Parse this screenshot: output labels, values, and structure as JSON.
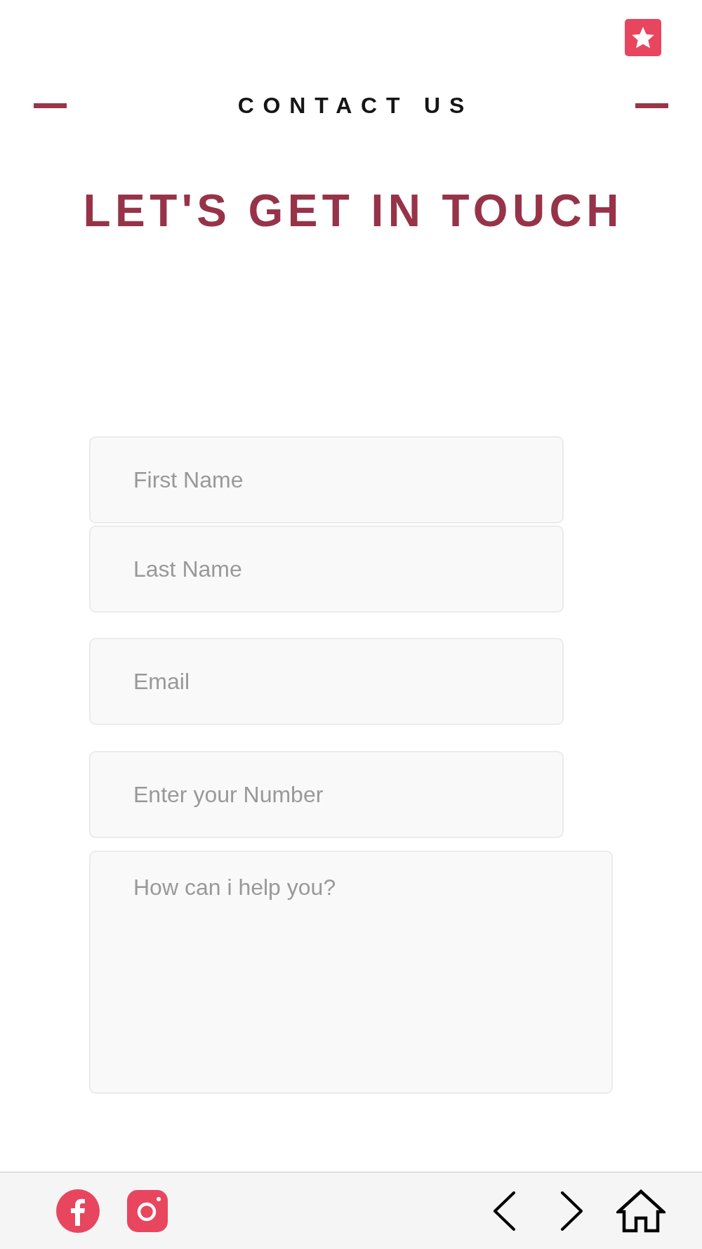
{
  "header": {
    "title": "CONTACT US"
  },
  "heading": "LET'S GET IN TOUCH",
  "form": {
    "fields": [
      {
        "kind": "input",
        "placeholder": "First Name"
      },
      {
        "kind": "input",
        "placeholder": "Last Name"
      },
      {
        "kind": "input",
        "placeholder": "Email"
      },
      {
        "kind": "input",
        "placeholder": "Enter your Number"
      },
      {
        "kind": "textarea",
        "placeholder": "How can i help you?"
      }
    ]
  }
}
